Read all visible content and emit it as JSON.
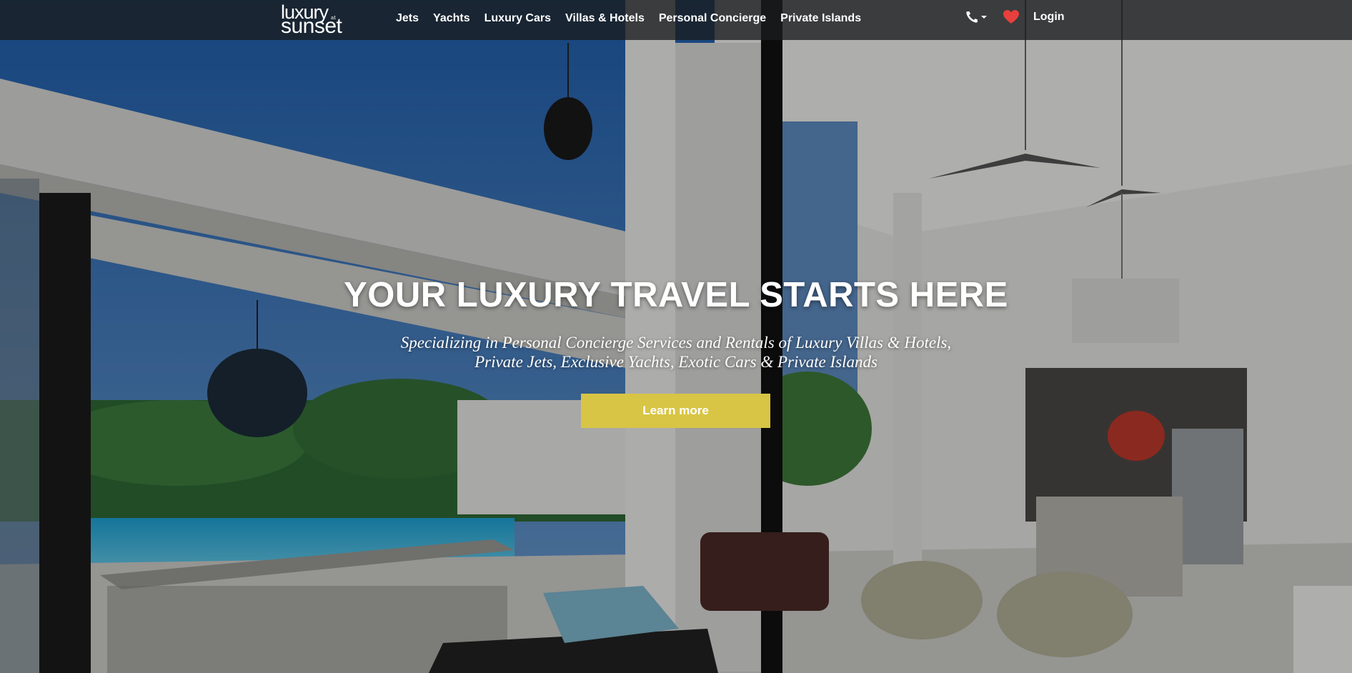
{
  "brand": {
    "logo_line1": "luxury",
    "logo_at": "at",
    "logo_line2": "sunset"
  },
  "nav": {
    "items": [
      {
        "label": "Jets"
      },
      {
        "label": "Yachts"
      },
      {
        "label": "Luxury Cars"
      },
      {
        "label": "Villas & Hotels"
      },
      {
        "label": "Personal Concierge"
      },
      {
        "label": "Private Islands"
      }
    ],
    "phone_icon": "phone-icon",
    "phone_dropdown_icon": "caret-down-icon",
    "favorites_icon": "heart-icon",
    "favorites_color": "#e8403c",
    "login_label": "Login"
  },
  "hero": {
    "headline": "YOUR LUXURY TRAVEL STARTS HERE",
    "subtitle": "Specializing in Personal Concierge Services and Rentals of Luxury Villas & Hotels, Private Jets, Exclusive Yachts, Exotic Cars & Private Islands",
    "cta_label": "Learn more",
    "cta_color": "#d8c545"
  }
}
